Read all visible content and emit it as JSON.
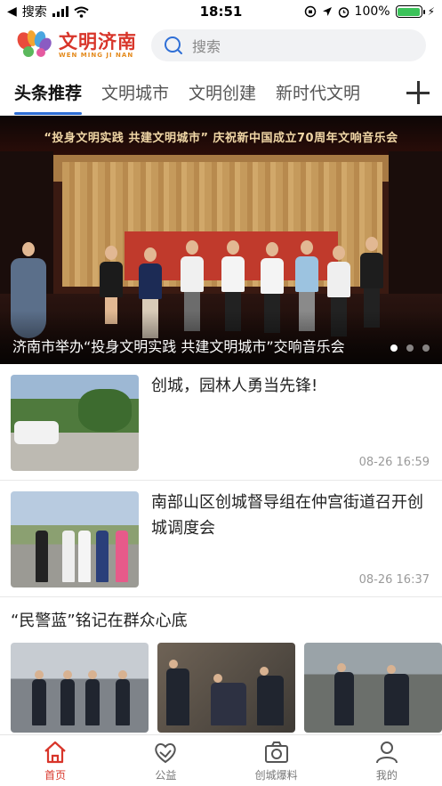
{
  "status_bar": {
    "back_app": "搜索",
    "time": "18:51",
    "battery": "100%",
    "battery_level": 1.0
  },
  "header": {
    "logo_cn": "文明济南",
    "logo_pinyin": "WEN MING JI NAN",
    "search_placeholder": "搜索"
  },
  "tabs": [
    {
      "label": "头条推荐"
    },
    {
      "label": "文明城市"
    },
    {
      "label": "文明创建"
    },
    {
      "label": "新时代文明"
    }
  ],
  "banner": {
    "stage_banner_text": "“投身文明实践 共建文明城市” 庆祝新中国成立70周年文响音乐会",
    "caption": "济南市举办“投身文明实践 共建文明城市”交响音乐会",
    "slide_count": 3,
    "active_slide": 1
  },
  "news": [
    {
      "title": "创城，园林人勇当先锋!",
      "time": "08-26 16:59"
    },
    {
      "title": "南部山区创城督导组在仲宫街道召开创城调度会",
      "time": "08-26 16:37"
    }
  ],
  "gallery": {
    "title": "“民警蓝”铭记在群众心底"
  },
  "bottom_nav": [
    {
      "label": "首页",
      "icon": "home-icon"
    },
    {
      "label": "公益",
      "icon": "heart-hands-icon"
    },
    {
      "label": "创城爆料",
      "icon": "camera-icon"
    },
    {
      "label": "我的",
      "icon": "user-icon"
    }
  ],
  "colors": {
    "accent_blue": "#2f6fd6",
    "brand_red": "#d8352a",
    "battery_green": "#3bc35a"
  }
}
